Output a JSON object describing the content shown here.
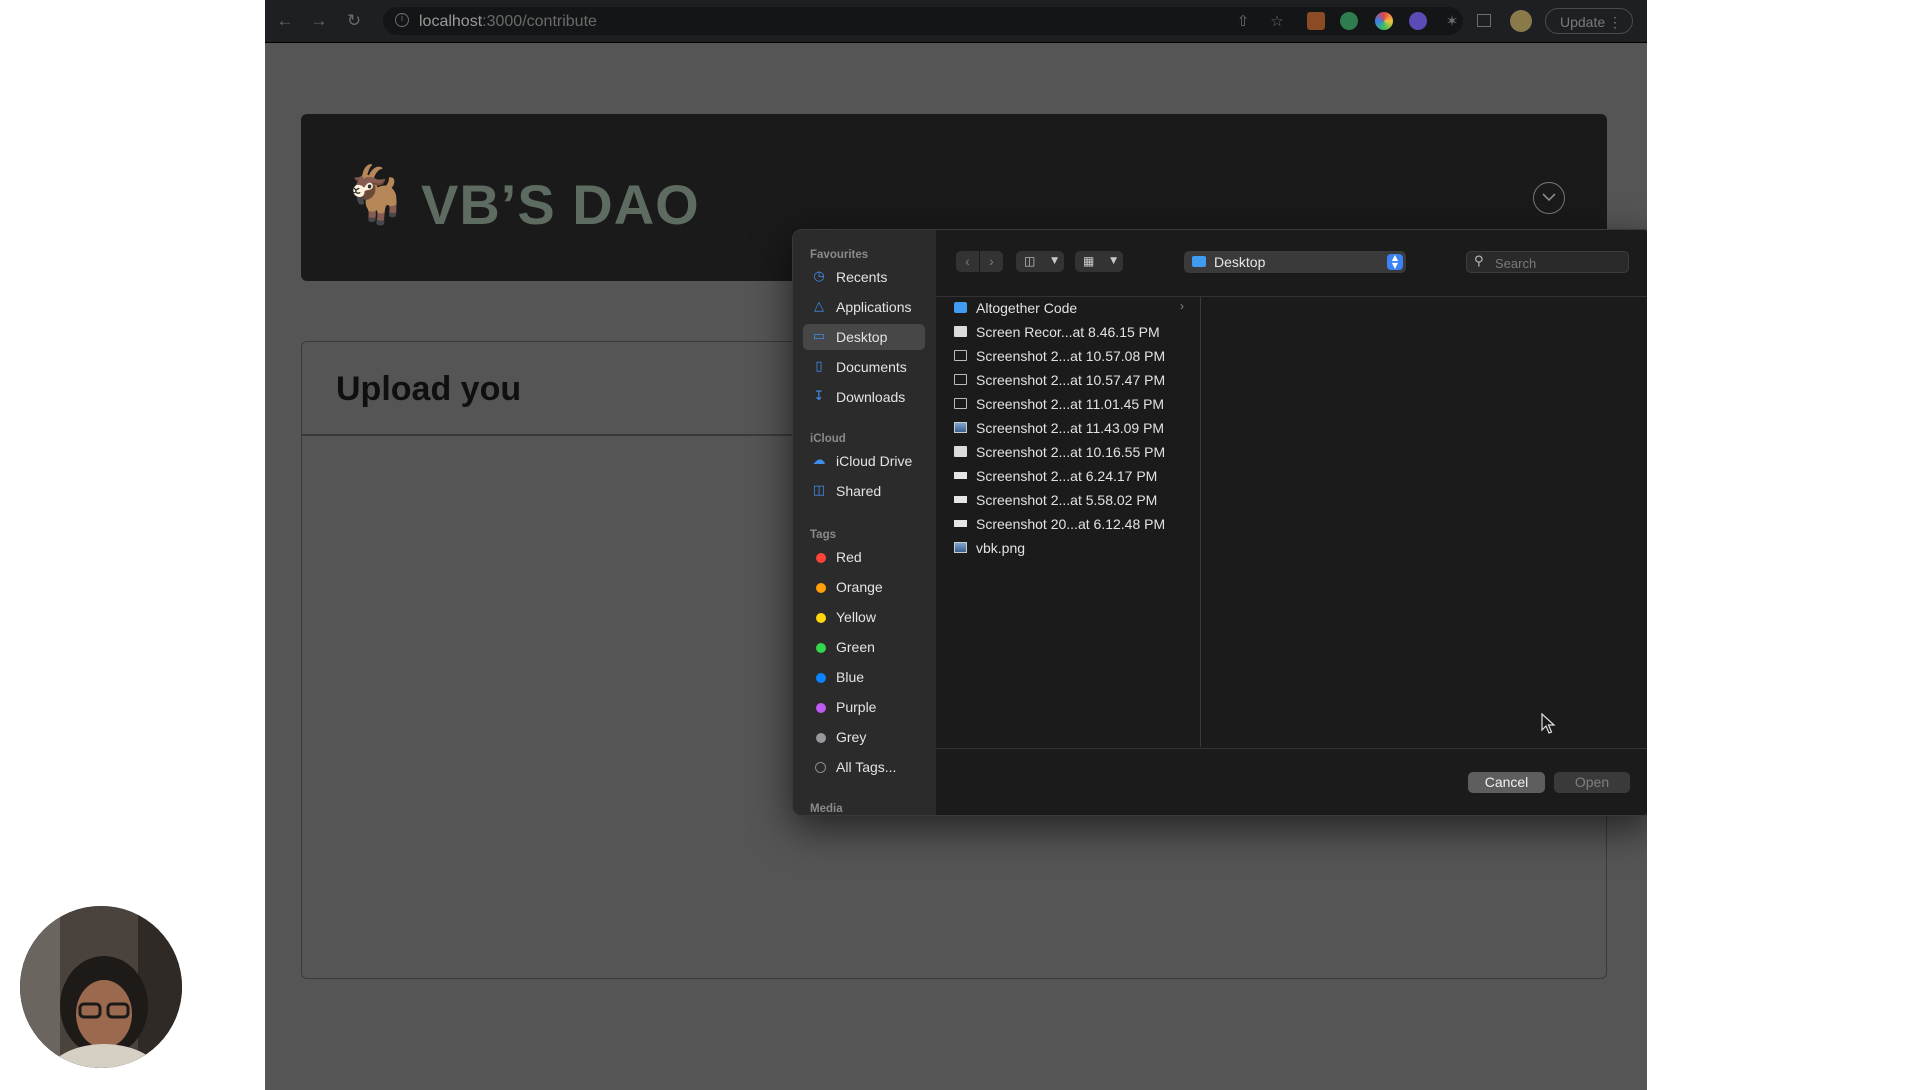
{
  "browser": {
    "url_host": "localhost",
    "url_path": ":3000/contribute",
    "update_label": "Update"
  },
  "page": {
    "brand_title": "VB’S DAO",
    "upload_heading": "Upload you"
  },
  "dialog": {
    "location": "Desktop",
    "search_placeholder": "Search",
    "cancel_label": "Cancel",
    "open_label": "Open",
    "sidebar": {
      "favourites_label": "Favourites",
      "favourites": [
        {
          "label": "Recents",
          "icon": "clock-icon"
        },
        {
          "label": "Applications",
          "icon": "applications-icon"
        },
        {
          "label": "Desktop",
          "icon": "desktop-icon"
        },
        {
          "label": "Documents",
          "icon": "document-icon"
        },
        {
          "label": "Downloads",
          "icon": "download-icon"
        }
      ],
      "icloud_label": "iCloud",
      "icloud": [
        {
          "label": "iCloud Drive",
          "icon": "cloud-icon"
        },
        {
          "label": "Shared",
          "icon": "shared-folder-icon"
        }
      ],
      "tags_label": "Tags",
      "tags": [
        {
          "label": "Red",
          "color": "#ff453a"
        },
        {
          "label": "Orange",
          "color": "#ff9f0a"
        },
        {
          "label": "Yellow",
          "color": "#ffd60a"
        },
        {
          "label": "Green",
          "color": "#32d74b"
        },
        {
          "label": "Blue",
          "color": "#0a84ff"
        },
        {
          "label": "Purple",
          "color": "#bf5af2"
        },
        {
          "label": "Grey",
          "color": "#98989d"
        },
        {
          "label": "All Tags...",
          "color": ""
        }
      ],
      "media_label": "Media"
    },
    "files": [
      {
        "name": "Altogether Code",
        "icon": "folder-icon"
      },
      {
        "name": "Screen Recor...at 8.46.15 PM",
        "icon": "image-file-icon"
      },
      {
        "name": "Screenshot 2...at 10.57.08 PM",
        "icon": "screenshot-file-icon"
      },
      {
        "name": "Screenshot 2...at 10.57.47 PM",
        "icon": "screenshot-file-icon"
      },
      {
        "name": "Screenshot 2...at 11.01.45 PM",
        "icon": "screenshot-file-icon"
      },
      {
        "name": "Screenshot 2...at 11.43.09 PM",
        "icon": "photo-file-icon"
      },
      {
        "name": "Screenshot 2...at 10.16.55 PM",
        "icon": "image-file-icon"
      },
      {
        "name": "Screenshot 2...at 6.24.17 PM",
        "icon": "strip-file-icon"
      },
      {
        "name": "Screenshot 2...at 5.58.02 PM",
        "icon": "strip-file-icon"
      },
      {
        "name": "Screenshot 20...at 6.12.48 PM",
        "icon": "strip-file-icon"
      },
      {
        "name": "vbk.png",
        "icon": "photo-file-icon"
      }
    ]
  }
}
